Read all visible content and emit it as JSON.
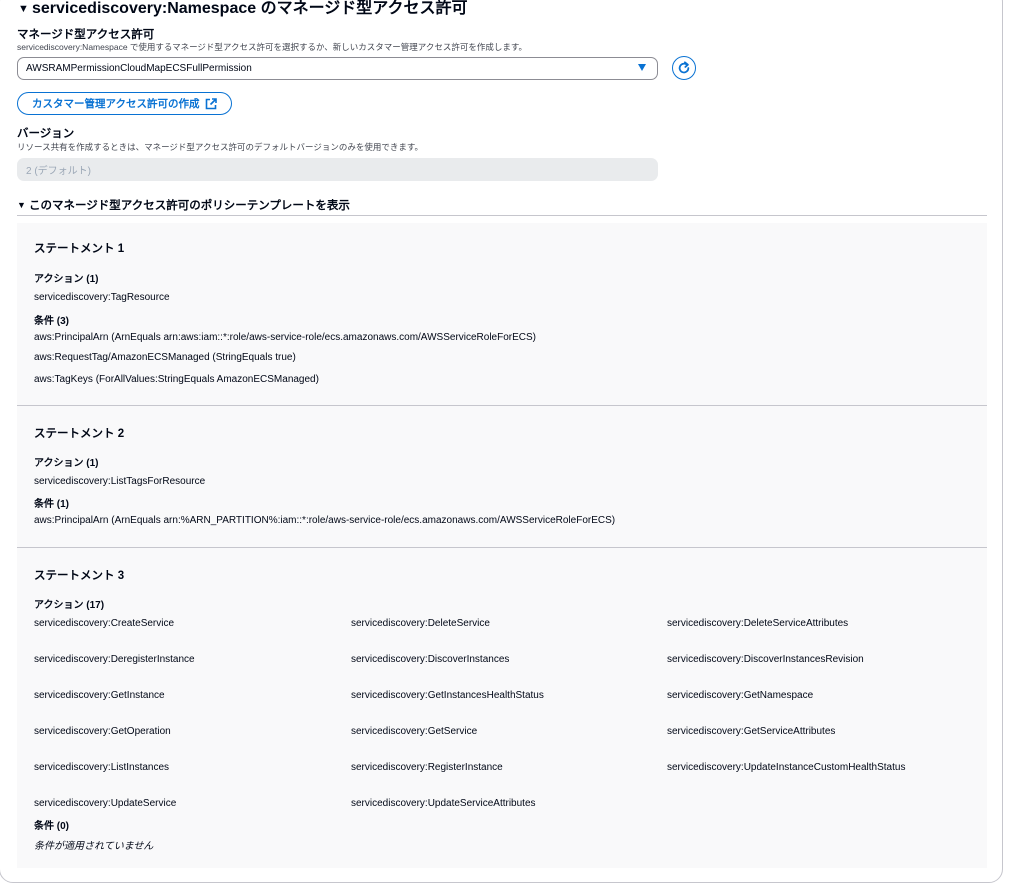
{
  "section": {
    "title": "servicediscovery:Namespace のマネージド型アクセス許可"
  },
  "managed_permission": {
    "label": "マネージド型アクセス許可",
    "description": "servicediscovery:Namespace で使用するマネージド型アクセス許可を選択するか、新しいカスタマー管理アクセス許可を作成します。",
    "selected": "AWSRAMPermissionCloudMapECSFullPermission",
    "create_button": "カスタマー管理アクセス許可の作成"
  },
  "version": {
    "label": "バージョン",
    "description": "リソース共有を作成するときは、マネージド型アクセス許可のデフォルトバージョンのみを使用できます。",
    "value": "2 (デフォルト)"
  },
  "policy_template": {
    "toggle_label": "このマネージド型アクセス許可のポリシーテンプレートを表示"
  },
  "statements": [
    {
      "title": "ステートメント 1",
      "actions_label": "アクション (1)",
      "actions": [
        "servicediscovery:TagResource"
      ],
      "conditions_label": "条件 (3)",
      "conditions": [
        "aws:PrincipalArn (ArnEquals arn:aws:iam::*:role/aws-service-role/ecs.amazonaws.com/AWSServiceRoleForECS)",
        "aws:RequestTag/AmazonECSManaged (StringEquals true)",
        "aws:TagKeys (ForAllValues:StringEquals AmazonECSManaged)"
      ]
    },
    {
      "title": "ステートメント 2",
      "actions_label": "アクション (1)",
      "actions": [
        "servicediscovery:ListTagsForResource"
      ],
      "conditions_label": "条件 (1)",
      "conditions": [
        "aws:PrincipalArn (ArnEquals arn:%ARN_PARTITION%:iam::*:role/aws-service-role/ecs.amazonaws.com/AWSServiceRoleForECS)"
      ]
    },
    {
      "title": "ステートメント 3",
      "actions_label": "アクション (17)",
      "actions": [
        "servicediscovery:CreateService",
        "servicediscovery:DeleteService",
        "servicediscovery:DeleteServiceAttributes",
        "servicediscovery:DeregisterInstance",
        "servicediscovery:DiscoverInstances",
        "servicediscovery:DiscoverInstancesRevision",
        "servicediscovery:GetInstance",
        "servicediscovery:GetInstancesHealthStatus",
        "servicediscovery:GetNamespace",
        "servicediscovery:GetOperation",
        "servicediscovery:GetService",
        "servicediscovery:GetServiceAttributes",
        "servicediscovery:ListInstances",
        "servicediscovery:RegisterInstance",
        "servicediscovery:UpdateInstanceCustomHealthStatus",
        "servicediscovery:UpdateService",
        "servicediscovery:UpdateServiceAttributes"
      ],
      "conditions_label": "条件 (0)",
      "no_conditions": "条件が適用されていません"
    }
  ],
  "colors": {
    "accent": "#0972d3",
    "text": "#000716",
    "muted": "#424650",
    "disabled_bg": "#e9ebed",
    "disabled_text": "#9ba7b6",
    "statement_bg": "#f9f9fa",
    "divider": "#c6c6cd"
  },
  "icons": {
    "caret": "caret-down-icon",
    "select_arrow": "triangle-down-icon",
    "refresh": "refresh-icon",
    "external": "external-link-icon"
  }
}
